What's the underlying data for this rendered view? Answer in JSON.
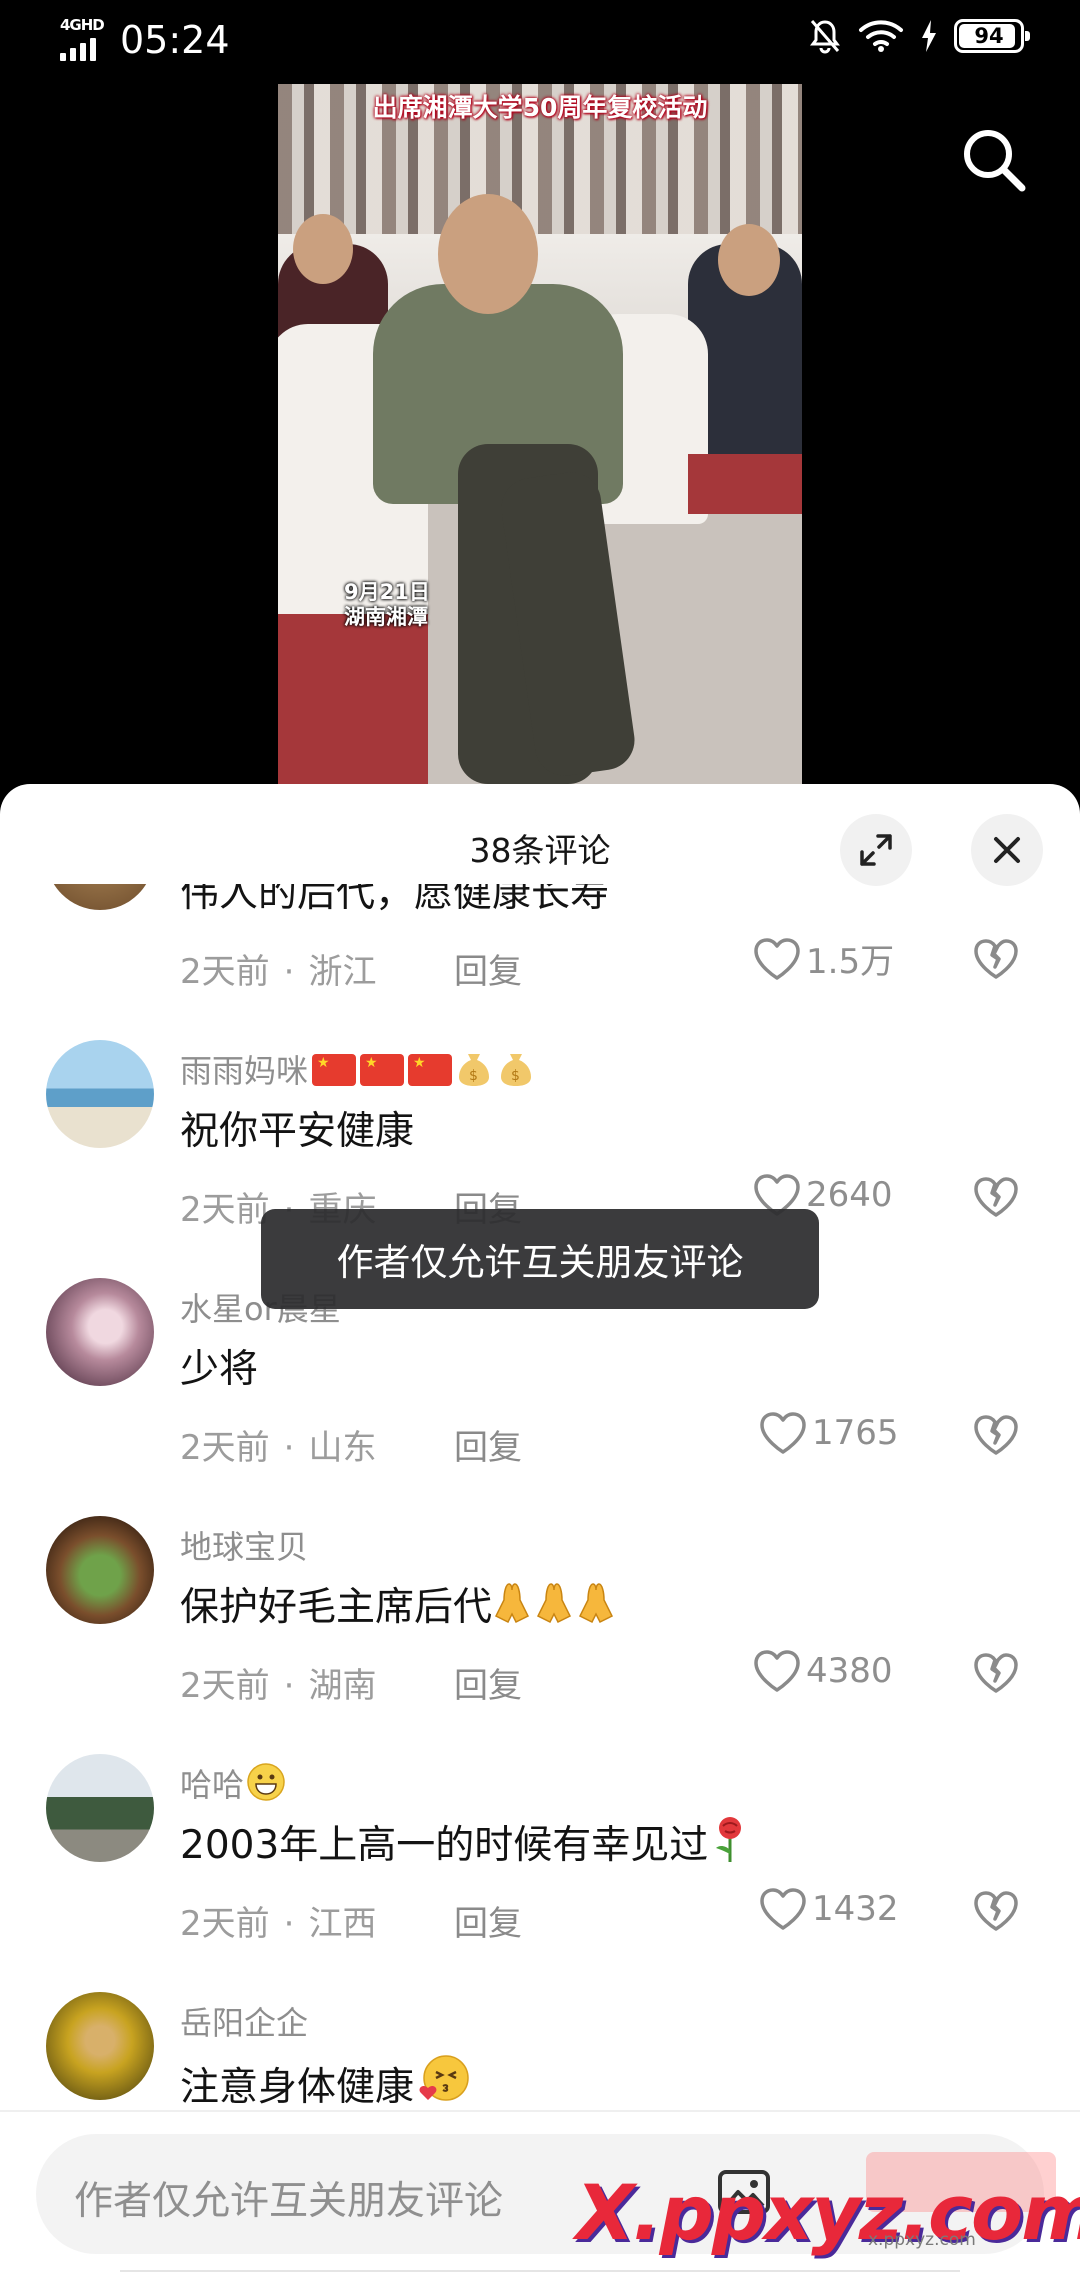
{
  "status_bar": {
    "network": "4GHD",
    "time": "05:24",
    "battery": "94",
    "battery_level": 0.94
  },
  "video": {
    "caption": "出席湘潭大学50周年复校活动",
    "date_line": "9月21日",
    "place_line": "湖南湘潭"
  },
  "comments_panel": {
    "title": "38条评论",
    "reply_label": "回复",
    "toast": "作者仅允许互关朋友评论",
    "comments": [
      {
        "user": "",
        "text": "伟人的后代，愿健康长寿",
        "time": "2天前",
        "location": "浙江",
        "likes": "1.5万",
        "avatar_color": "#8a6a45"
      },
      {
        "user": "雨雨妈咪",
        "text": "祝你平安健康",
        "time": "2天前",
        "location": "重庆",
        "likes": "2640",
        "avatar_color": "#7fb6d8"
      },
      {
        "user": "水星or晨星",
        "text": "少将",
        "time": "2天前",
        "location": "山东",
        "likes": "1765",
        "avatar_color": "#c9a3b4"
      },
      {
        "user": "地球宝贝",
        "text": "保护好毛主席后代",
        "time": "2天前",
        "location": "湖南",
        "likes": "4380",
        "avatar_color": "#5d3a22"
      },
      {
        "user": "哈哈",
        "text": "2003年上高一的时候有幸见过",
        "time": "2天前",
        "location": "江西",
        "likes": "1432",
        "avatar_color": "#4f6a52"
      },
      {
        "user": "岳阳企企",
        "text": "注意身体健康",
        "time": "",
        "location": "",
        "likes": "",
        "avatar_color": "#b99a2a"
      }
    ]
  },
  "input": {
    "placeholder": "作者仅允许互关朋友评论"
  },
  "watermark": {
    "main": "X.ppxyz.com",
    "sub": "x.ppxyz.com"
  },
  "icons": {
    "search": "search-icon",
    "expand": "expand-icon",
    "close": "close-icon",
    "like": "heart-icon",
    "dislike": "broken-heart-icon",
    "image": "image-icon"
  }
}
